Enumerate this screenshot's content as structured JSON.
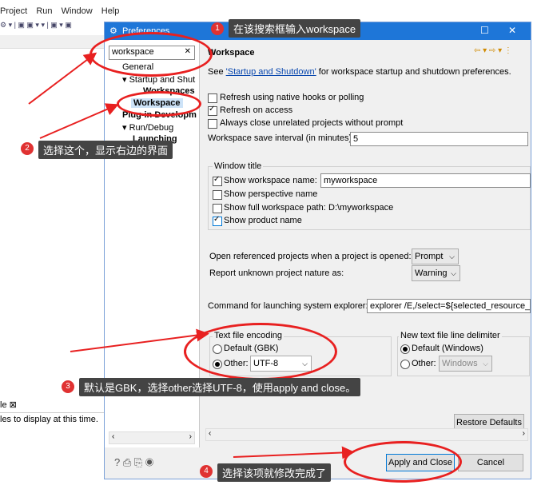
{
  "menubar": [
    "Project",
    "Run",
    "Window",
    "Help"
  ],
  "bg_view": {
    "tab_label": "le ⊠",
    "message": "les to display at this time."
  },
  "dialog": {
    "title": "Preferences",
    "filter_value": "workspace",
    "tree": [
      {
        "label": "General",
        "bold": false
      },
      {
        "label": "▾ Startup and Shut",
        "bold": false
      },
      {
        "label": "Workspaces",
        "bold": true
      },
      {
        "label": "Workspace",
        "bold": true
      },
      {
        "label": "Plug-in Developm",
        "bold": true
      },
      {
        "label": "▾ Run/Debug",
        "bold": false
      },
      {
        "label": "Launching",
        "bold": true
      }
    ],
    "page": {
      "title": "Workspace",
      "see_prefix": "See ",
      "see_link": "'Startup and Shutdown'",
      "see_suffix": " for workspace startup and shutdown preferences.",
      "opt_refresh_native": "Refresh using native hooks or polling",
      "opt_refresh_access": "Refresh on access",
      "opt_close_unrelated": "Always close unrelated projects without prompt",
      "save_interval_label": "Workspace save interval (in minutes):",
      "save_interval_value": "5",
      "window_title_group": "Window title",
      "show_ws_name": "Show workspace name:",
      "ws_name_value": "myworkspace",
      "show_perspective": "Show perspective name",
      "show_full_path": "Show full workspace path:",
      "full_path_value": "D:\\myworkspace",
      "show_product": "Show product name",
      "open_ref_label": "Open referenced projects when a project is opened:",
      "open_ref_value": "Prompt",
      "unknown_nature_label": "Report unknown project nature as:",
      "unknown_nature_value": "Warning",
      "explorer_label": "Command for launching system explorer:",
      "explorer_value": "explorer /E,/select=${selected_resource_l",
      "encoding_group": "Text file encoding",
      "encoding_default": "Default (GBK)",
      "encoding_other": "Other:",
      "encoding_other_value": "UTF-8",
      "delimiter_group": "New text file line delimiter",
      "delimiter_default": "Default (Windows)",
      "delimiter_other": "Other:",
      "delimiter_other_value": "Windows",
      "restore_defaults": "Restore Defaults"
    },
    "apply_close": "Apply and Close",
    "cancel": "Cancel"
  },
  "annotations": {
    "a1": "在该搜索框输入workspace",
    "a2": "选择这个，显示右边的界面",
    "a3": "默认是GBK，选择other选择UTF-8，使用apply and close。",
    "a4": "选择该项就修改完成了",
    "n1": "1",
    "n2": "2",
    "n3": "3",
    "n4": "4"
  }
}
